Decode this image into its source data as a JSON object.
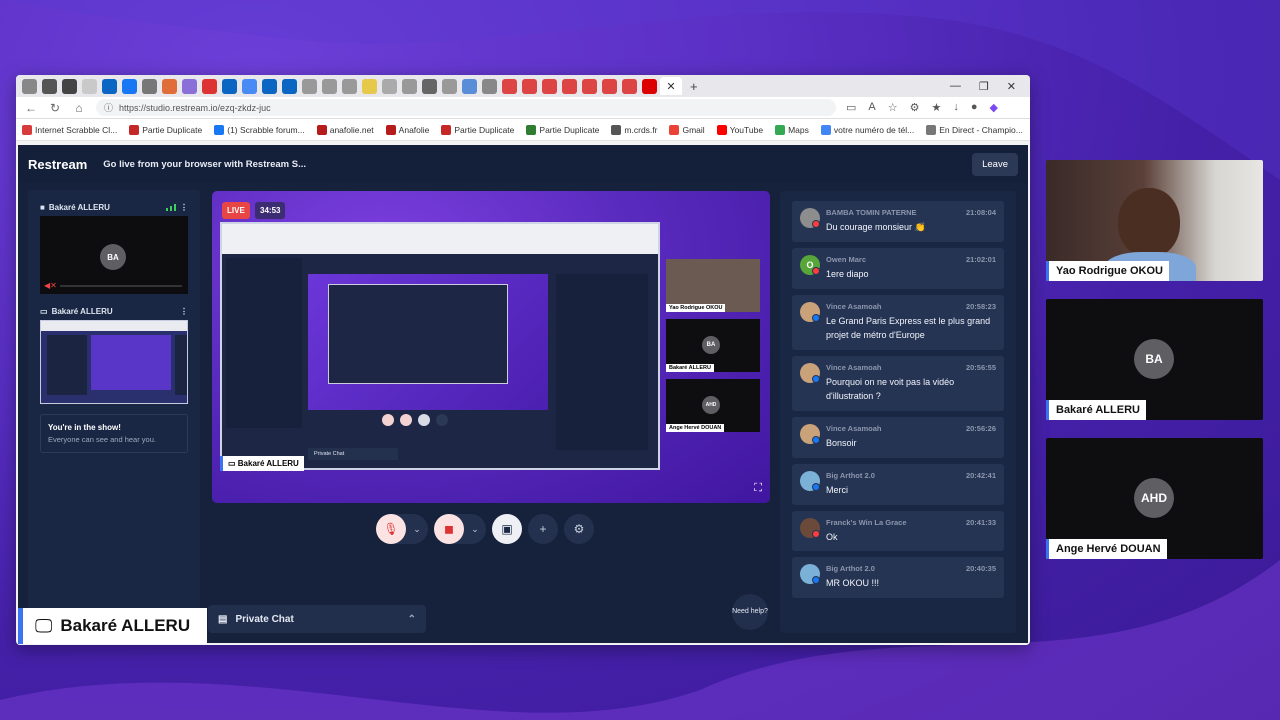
{
  "browser": {
    "url": "https://studio.restream.io/ezq-zkdz-juc",
    "bookmarks": [
      {
        "label": "Internet Scrabble Cl...",
        "color": "#d83b3b"
      },
      {
        "label": "Partie Duplicate",
        "color": "#c62828"
      },
      {
        "label": "(1) Scrabble forum...",
        "color": "#1877f2"
      },
      {
        "label": "anafolie.net",
        "color": "#b71c1c"
      },
      {
        "label": "Anafolie",
        "color": "#b71c1c"
      },
      {
        "label": "Partie Duplicate",
        "color": "#c62828"
      },
      {
        "label": "Partie Duplicate",
        "color": "#2e7d32"
      },
      {
        "label": "m.crds.fr",
        "color": "#555555"
      },
      {
        "label": "Gmail",
        "color": "#ea4335"
      },
      {
        "label": "YouTube",
        "color": "#ff0000"
      },
      {
        "label": "Maps",
        "color": "#34a853"
      },
      {
        "label": "votre numéro de tél...",
        "color": "#4285f4"
      },
      {
        "label": "En Direct - Champio...",
        "color": "#777777"
      }
    ]
  },
  "app": {
    "brand": "Restream",
    "title": "Go live from your browser with Restream S...",
    "leave_label": "Leave"
  },
  "left_panel": {
    "camera_label": "Bakaré ALLERU",
    "camera_initials": "BA",
    "screen_label": "Bakaré ALLERU",
    "show_title": "You're in the show!",
    "show_subtitle": "Everyone can see and hear you."
  },
  "stage": {
    "live_label": "LIVE",
    "timer": "34:53",
    "name_tag": "Bakaré ALLERU",
    "inner_private_chat": "Private Chat",
    "side_cams": [
      {
        "label": "Yao Rodrigue OKOU",
        "initials": ""
      },
      {
        "label": "Bakaré ALLERU",
        "initials": "BA"
      },
      {
        "label": "Ange Hervé DOUAN",
        "initials": "AHD"
      }
    ]
  },
  "private_chat": {
    "label": "Private Chat"
  },
  "need_help": {
    "label": "Need help?"
  },
  "chat": [
    {
      "author": "BAMBA TOMIN PATERNE",
      "time": "21:08:04",
      "message": "Du courage monsieur 👏",
      "avatar_color": "#8d8d8d",
      "platform_color": "#ff3d3d"
    },
    {
      "author": "Owen Marc",
      "time": "21:02:01",
      "message": "1ere diapo",
      "avatar_color": "#57a639",
      "avatar_letter": "O",
      "platform_color": "#ff3d3d"
    },
    {
      "author": "Vince Asamoah",
      "time": "20:58:23",
      "message": "Le Grand Paris Express est le plus grand projet de métro d'Europe",
      "avatar_color": "#c9a27a",
      "platform_color": "#1877f2"
    },
    {
      "author": "Vince Asamoah",
      "time": "20:56:55",
      "message": "Pourquoi on ne voit pas la vidéo d'illustration ?",
      "avatar_color": "#c9a27a",
      "platform_color": "#1877f2"
    },
    {
      "author": "Vince Asamoah",
      "time": "20:56:26",
      "message": "Bonsoir",
      "avatar_color": "#c9a27a",
      "platform_color": "#1877f2"
    },
    {
      "author": "Big Arthot 2.0",
      "time": "20:42:41",
      "message": "Merci",
      "avatar_color": "#7bb1d6",
      "platform_color": "#1877f2"
    },
    {
      "author": "Franck's Win La Grace",
      "time": "20:41:33",
      "message": "Ok",
      "avatar_color": "#6b4a3a",
      "platform_color": "#ff3d3d"
    },
    {
      "author": "Big Arthot 2.0",
      "time": "20:40:35",
      "message": "MR OKOU !!!",
      "avatar_color": "#7bb1d6",
      "platform_color": "#1877f2"
    }
  ],
  "overlay": {
    "presenter_name": "Bakaré ALLERU",
    "right_cams": [
      {
        "label": "Yao Rodrigue OKOU",
        "initials": ""
      },
      {
        "label": "Bakaré ALLERU",
        "initials": "BA"
      },
      {
        "label": "Ange Hervé DOUAN",
        "initials": "AHD"
      }
    ]
  },
  "colors": {
    "accent_blue": "#3b73f0",
    "live_red": "#e84545",
    "panel_bg": "#1a2744"
  }
}
